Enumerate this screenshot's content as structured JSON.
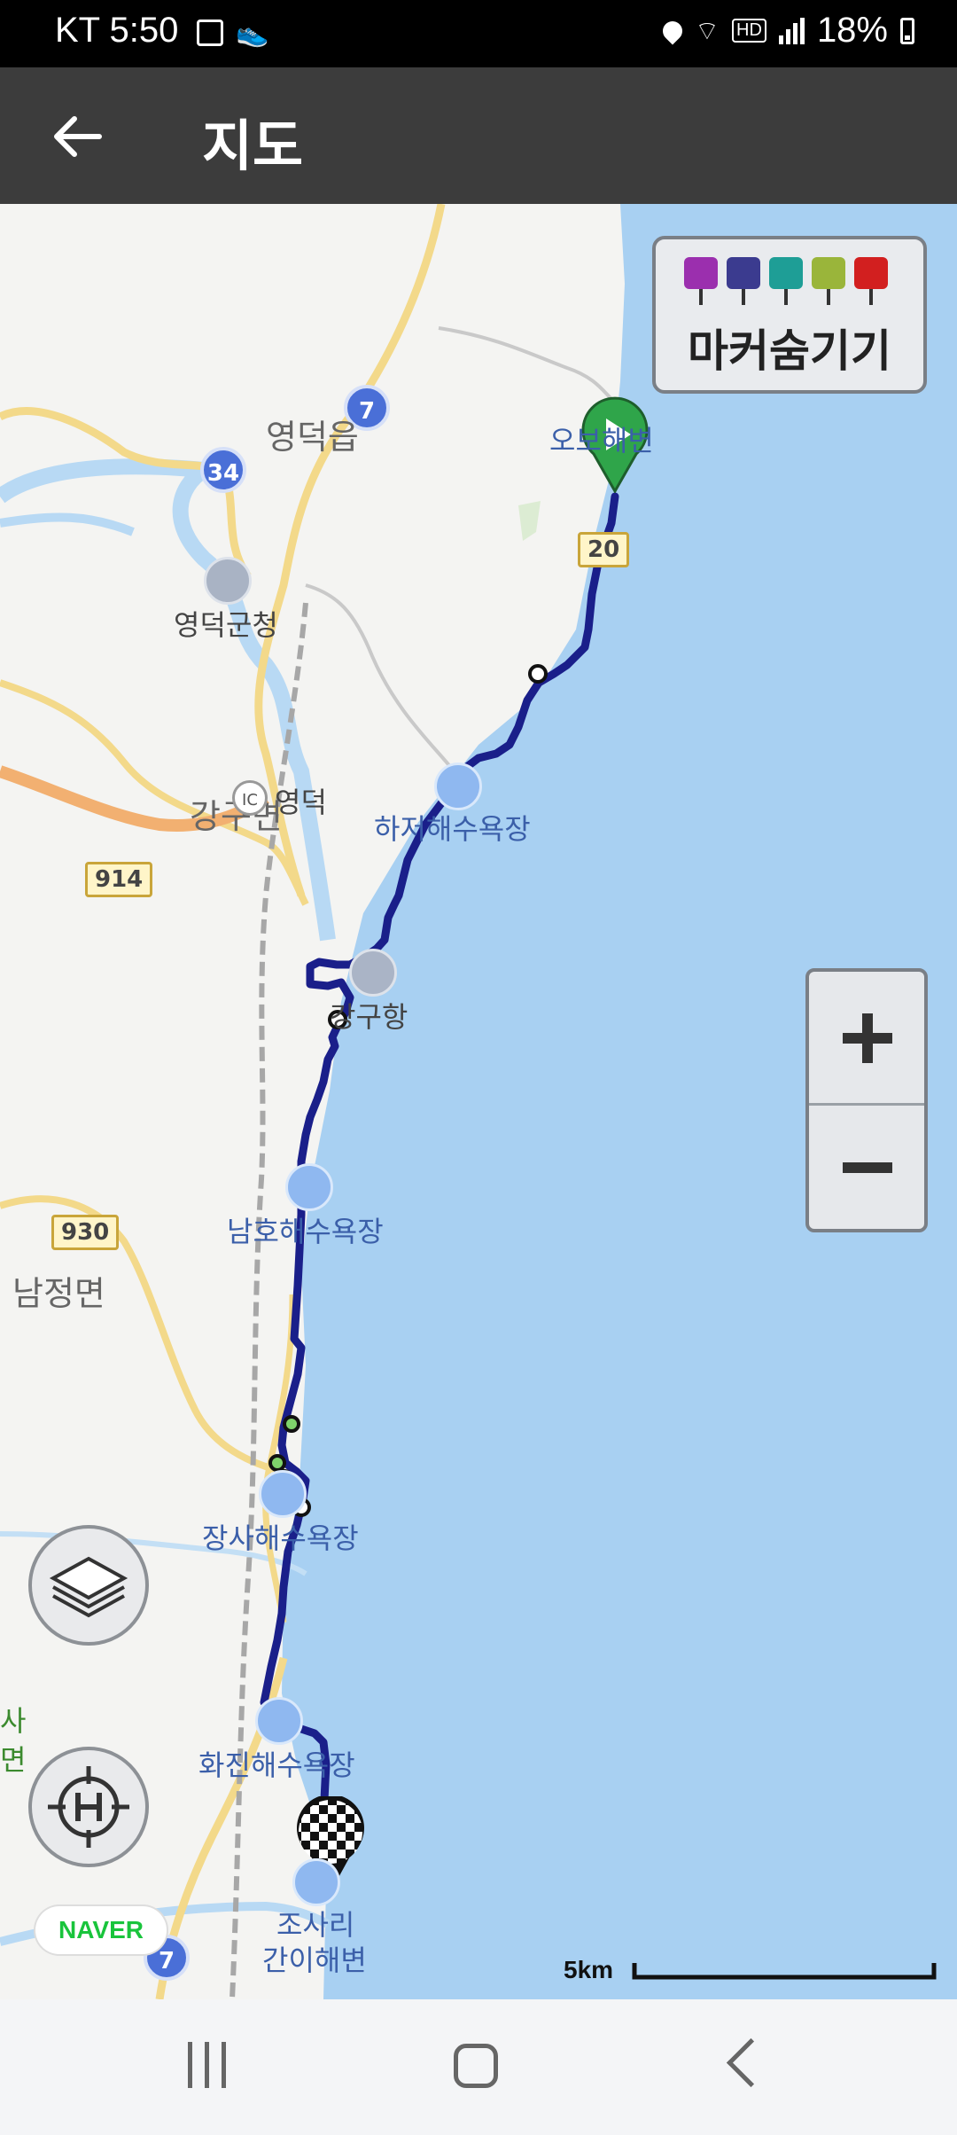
{
  "status_bar": {
    "time": "KT 5:50",
    "hd": "HD",
    "battery": "18%"
  },
  "app_bar": {
    "title": "지도"
  },
  "marker_toggle": {
    "label": "마커숨기기",
    "pin_colors": [
      "#9b2fae",
      "#3b3b8f",
      "#1e9e96",
      "#9ab53a",
      "#d21f1f"
    ]
  },
  "map": {
    "towns": [
      "영덕읍",
      "영덕군청",
      "강구면",
      "영덕",
      "남정면"
    ],
    "pois": [
      "하저해수욕장",
      "강구항",
      "남호해수욕장",
      "장사해수욕장",
      "화진해수욕장",
      "조사리",
      "간이해변"
    ],
    "partial_labels": [
      "오보해변",
      "사",
      "면"
    ],
    "road_numbers": [
      "7",
      "34",
      "20",
      "914",
      "930",
      "7"
    ],
    "interchange": "IC",
    "route_color": "#1a1f8a"
  },
  "naver_logo": "NAVER",
  "scale_label": "5km"
}
